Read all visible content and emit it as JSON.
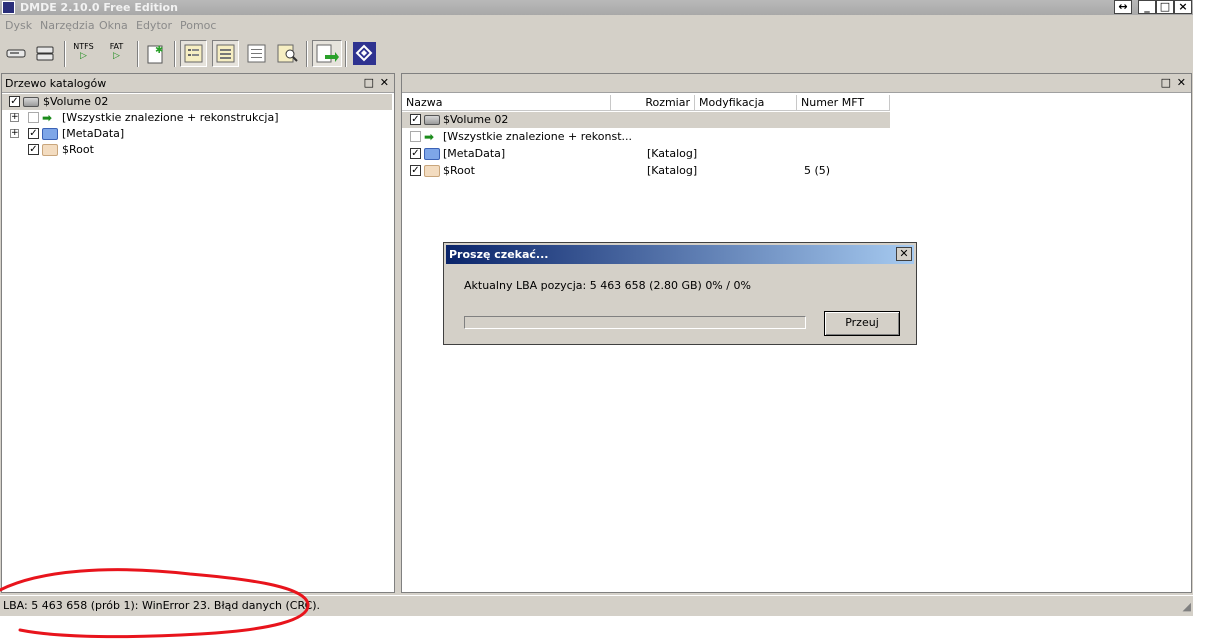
{
  "window": {
    "title": "DMDE 2.10.0 Free Edition"
  },
  "menu": [
    "Dysk",
    "Narzędzia",
    "Okna",
    "Edytor",
    "Pomoc"
  ],
  "toolbar": {
    "ntfs_label": "NTFS",
    "fat_label": "FAT"
  },
  "tree_panel": {
    "title": "Drzewo katalogów",
    "items": [
      {
        "label": "$Volume 02",
        "icon": "drive-icon",
        "checked": true
      },
      {
        "label": "[Wszystkie znalezione + rekonstrukcja]",
        "icon": "green-arrow-icon",
        "checked": false
      },
      {
        "label": "[MetaData]",
        "icon": "folder-blue-icon",
        "checked": true
      },
      {
        "label": "$Root",
        "icon": "folder-tan-icon",
        "checked": true
      }
    ]
  },
  "list_panel": {
    "columns": [
      "Nazwa",
      "Rozmiar",
      "Modyfikacja",
      "Numer MFT"
    ],
    "rows": [
      {
        "name": "$Volume 02",
        "size": "",
        "mod": "",
        "mft": ""
      },
      {
        "name": "[Wszystkie znalezione + rekonst...",
        "size": "",
        "mod": "",
        "mft": ""
      },
      {
        "name": "[MetaData]",
        "size": "[Katalog]",
        "mod": "",
        "mft": ""
      },
      {
        "name": "$Root",
        "size": "[Katalog]",
        "mod": "",
        "mft": "5 (5)"
      }
    ]
  },
  "dialog": {
    "title": "Proszę czekać...",
    "message": "Aktualny LBA pozycja: 5 463 658 (2.80 GB) 0% / 0%",
    "progress": 0,
    "button": "Przeuj"
  },
  "status": {
    "text": "LBA: 5 463 658 (prób 1): WinError 23. Błąd danych (CRC)."
  },
  "colors": {
    "title_gradient_start": "#0a246a",
    "title_gradient_end": "#a6caf0",
    "annotation": "#e8141c"
  }
}
